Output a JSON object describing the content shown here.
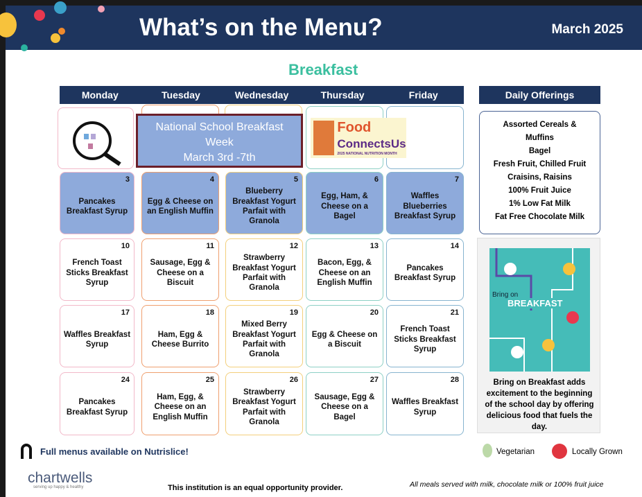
{
  "header": {
    "title": "What’s on the Menu?",
    "month": "March 2025"
  },
  "meal": "Breakfast",
  "days": [
    "Monday",
    "Tuesday",
    "Wednesday",
    "Thursday",
    "Friday"
  ],
  "daily_offerings_title": "Daily Offerings",
  "special": {
    "nsbw_line1": "National School Breakfast",
    "nsbw_line2": "Week",
    "nsbw_dates": "March 3rd -7th",
    "food_logo_line1": "Food",
    "food_logo_line2": "ConnectsUs",
    "food_logo_sub": "2025 NATIONAL NUTRITION MONTH"
  },
  "weeks": [
    [
      {
        "day": "3",
        "menu": "Pancakes Breakfast Syrup"
      },
      {
        "day": "4",
        "menu": "Egg & Cheese on an English Muffin"
      },
      {
        "day": "5",
        "menu": "Blueberry Breakfast Yogurt Parfait with Granola"
      },
      {
        "day": "6",
        "menu": "Egg, Ham, & Cheese on a Bagel"
      },
      {
        "day": "7",
        "menu": "Waffles Blueberries Breakfast Syrup"
      }
    ],
    [
      {
        "day": "10",
        "menu": "French Toast Sticks Breakfast Syrup"
      },
      {
        "day": "11",
        "menu": "Sausage, Egg & Cheese on a Biscuit"
      },
      {
        "day": "12",
        "menu": "Strawberry Breakfast Yogurt Parfait with Granola"
      },
      {
        "day": "13",
        "menu": "Bacon, Egg, & Cheese on an English Muffin"
      },
      {
        "day": "14",
        "menu": "Pancakes Breakfast Syrup"
      }
    ],
    [
      {
        "day": "17",
        "menu": "Waffles Breakfast Syrup"
      },
      {
        "day": "18",
        "menu": "Ham, Egg & Cheese Burrito"
      },
      {
        "day": "19",
        "menu": "Mixed Berry Breakfast Yogurt Parfait with Granola"
      },
      {
        "day": "20",
        "menu": "Egg & Cheese on a Biscuit"
      },
      {
        "day": "21",
        "menu": "French Toast Sticks Breakfast Syrup"
      }
    ],
    [
      {
        "day": "24",
        "menu": "Pancakes Breakfast Syrup"
      },
      {
        "day": "25",
        "menu": "Ham, Egg, & Cheese on an English Muffin"
      },
      {
        "day": "26",
        "menu": "Strawberry Breakfast Yogurt Parfait with Granola"
      },
      {
        "day": "27",
        "menu": "Sausage, Egg & Cheese on a Bagel"
      },
      {
        "day": "28",
        "menu": "Waffles Breakfast Syrup"
      }
    ]
  ],
  "daily_offerings": [
    "Assorted Cereals &",
    "Muffins",
    "Bagel",
    "Fresh Fruit, Chilled Fruit",
    "Craisins, Raisins",
    "100% Fruit Juice",
    "1% Low Fat Milk",
    "Fat Free Chocolate Milk"
  ],
  "poster": {
    "title": "BREAKFAST",
    "bring_on": "Bring on",
    "caption": "Bring on Breakfast adds excitement to the beginning of the school day by offering delicious food that fuels the day."
  },
  "footer": {
    "nutrislice": "Full menus available on Nutrislice!",
    "legend_veg": "Vegetarian",
    "legend_local": "Locally Grown",
    "brand": "chartwells",
    "brand_tag": "serving up happy & healthy",
    "equal": "This institution is an equal opportunity provider.",
    "milk": "All meals served with milk, chocolate milk or 100% fruit juice"
  },
  "colors": {
    "navy": "#1e355e",
    "teal": "#3bbf9f",
    "highlight": "#8eaadb"
  }
}
